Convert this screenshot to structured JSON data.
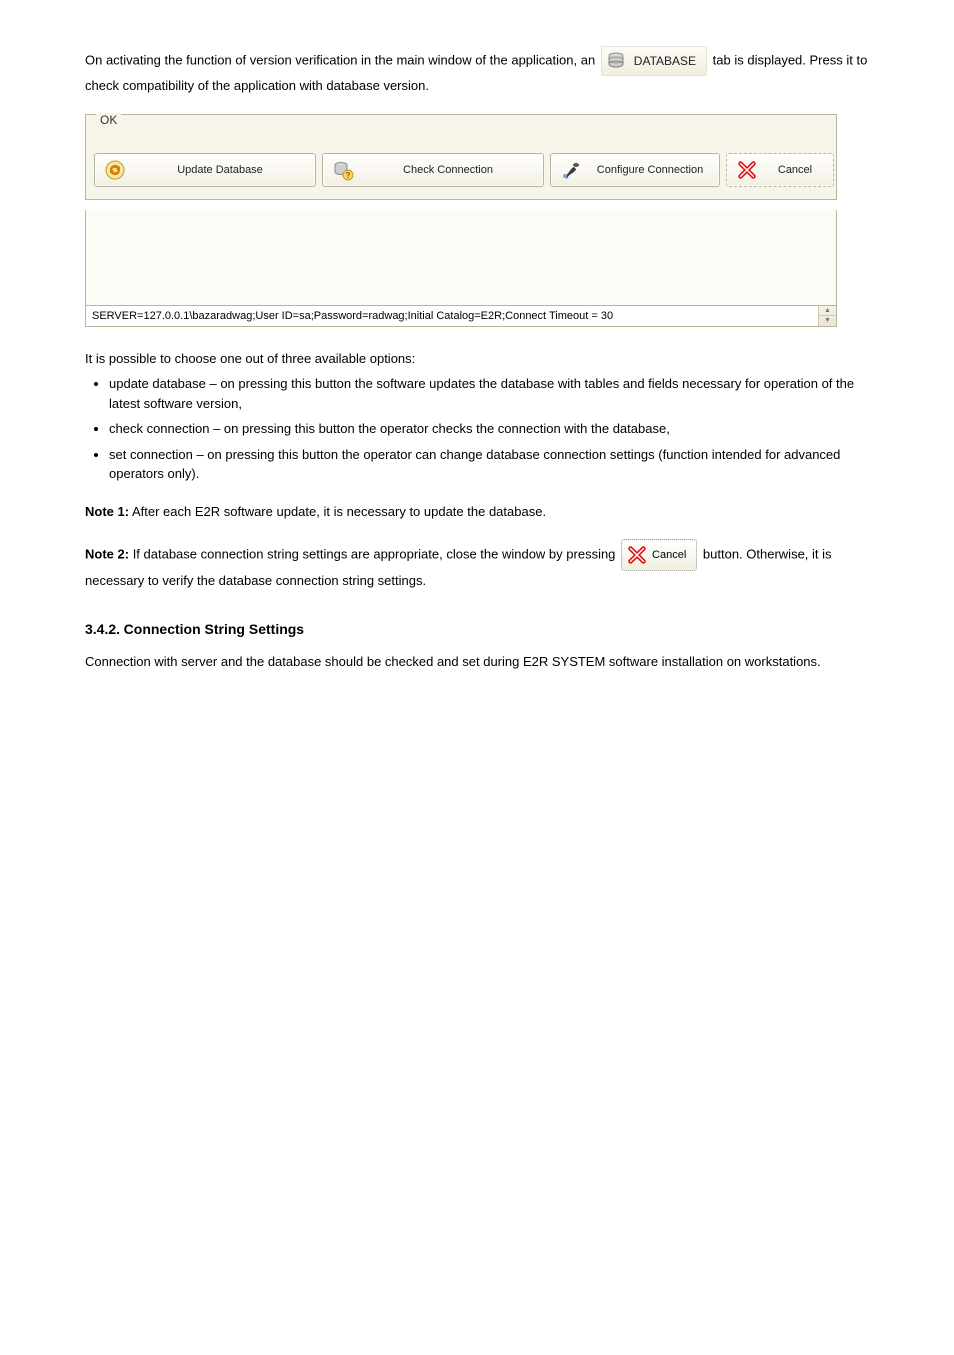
{
  "para1_a": "On activating the function of version verification in the main window of the application, an ",
  "para1_b": " tab is displayed. Press it to check compatibility of the application with database version.",
  "db_button_label": "DATABASE",
  "window_title": "OK",
  "buttons": {
    "update": "Update Database",
    "check": "Check Connection",
    "configure": "Configure Connection",
    "cancel": "Cancel"
  },
  "connection_string": "SERVER=127.0.0.1\\bazaradwag;User ID=sa;Password=radwag;Initial Catalog=E2R;Connect Timeout = 30",
  "desc_line": "It is possible to choose one out of three available options:",
  "bullets": [
    "update database – on pressing this button the software updates the database with tables and fields necessary for operation of the latest software version,",
    "check connection – on pressing this button the operator checks the connection with the database,",
    "set connection – on pressing this button the operator can change database connection settings (function intended for advanced operators only)."
  ],
  "note1_label": "Note 1:",
  "note1_text": " After each E2R software update, it is necessary to update the database.",
  "note2_label": "Note 2:",
  "note2_text_a": " If database connection string settings are appropriate, close the window by pressing ",
  "note2_text_b": " button. Otherwise, it is necessary to verify the database connection string settings.",
  "section": {
    "num": "3.4.2.",
    "title": " Connection String Settings"
  },
  "final_para": "Connection with server and the database should be checked and set during E2R SYSTEM software installation on workstations."
}
